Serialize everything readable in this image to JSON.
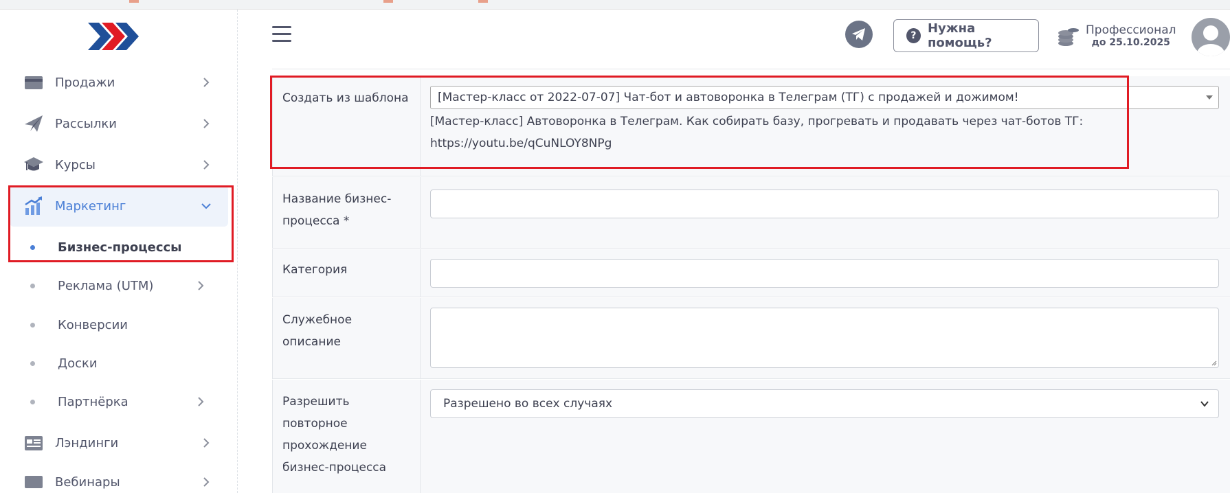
{
  "sidebar": {
    "items": [
      {
        "label": "Продажи",
        "icon": "card-icon"
      },
      {
        "label": "Рассылки",
        "icon": "paper-plane-icon"
      },
      {
        "label": "Курсы",
        "icon": "graduation-cap-icon"
      },
      {
        "label": "Маркетинг",
        "icon": "chart-growth-icon"
      },
      {
        "label": "Лэндинги",
        "icon": "landing-page-icon"
      },
      {
        "label": "Вебинары",
        "icon": "monitor-icon"
      }
    ],
    "marketing_sub": [
      {
        "label": "Бизнес-процессы"
      },
      {
        "label": "Реклама (UTM)"
      },
      {
        "label": "Конверсии"
      },
      {
        "label": "Доски"
      },
      {
        "label": "Партнёрка"
      }
    ]
  },
  "header": {
    "help_label": "Нужна помощь?",
    "help_icon_text": "?",
    "plan_name": "Профессионал",
    "plan_until": "до 25.10.2025"
  },
  "form": {
    "template_label": "Создать из шаблона",
    "template_selected": "[Мастер-класс от 2022-07-07] Чат-бот и автоворонка в Телеграм (ТГ) с продажей и дожимом!",
    "template_description": "[Мастер-класс] Автоворонка в Телеграм. Как собирать базу, прогревать и продавать через чат-ботов ТГ:",
    "template_link": "https://youtu.be/qCuNLOY8NPg",
    "name_label": "Название бизнес-процесса *",
    "name_value": "",
    "category_label": "Категория",
    "category_value": "",
    "description_label": "Служебное описание",
    "description_value": "",
    "repeat_label": "Разрешить повторное прохождение бизнес-процесса",
    "repeat_selected": "Разрешено во всех случаях"
  },
  "colors": {
    "accent": "#4a7fd6",
    "highlight_border": "#e01b24",
    "logo_blue": "#1f4f99",
    "logo_red": "#e01b24"
  }
}
